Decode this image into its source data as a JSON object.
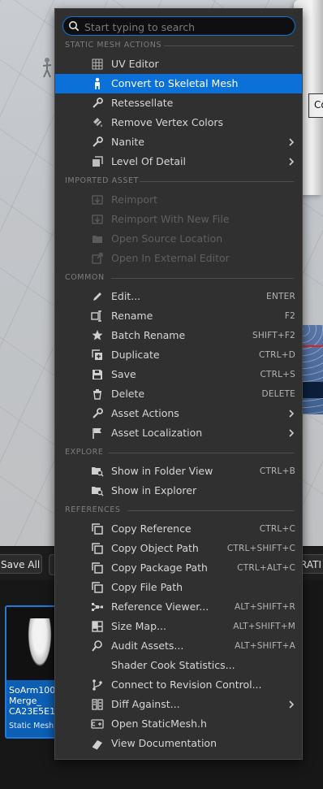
{
  "search": {
    "placeholder": "Start typing to search",
    "value": ""
  },
  "sections": {
    "static_mesh_actions": "STATIC MESH ACTIONS",
    "imported_asset": "IMPORTED ASSET",
    "common": "COMMON",
    "explore": "EXPLORE",
    "references": "REFERENCES"
  },
  "items": {
    "uv_editor": "UV Editor",
    "convert_skeletal": "Convert to Skeletal Mesh",
    "retessellate": "Retessellate",
    "remove_vertex_colors": "Remove Vertex Colors",
    "nanite": "Nanite",
    "level_of_detail": "Level Of Detail",
    "reimport": "Reimport",
    "reimport_new_file": "Reimport With New File",
    "open_source_location": "Open Source Location",
    "open_external_editor": "Open In External Editor",
    "edit": "Edit...",
    "rename": "Rename",
    "batch_rename": "Batch Rename",
    "duplicate": "Duplicate",
    "save": "Save",
    "delete": "Delete",
    "asset_actions": "Asset Actions",
    "asset_localization": "Asset Localization",
    "show_folder_view": "Show in Folder View",
    "show_explorer": "Show in Explorer",
    "copy_reference": "Copy Reference",
    "copy_object_path": "Copy Object Path",
    "copy_package_path": "Copy Package Path",
    "copy_file_path": "Copy File Path",
    "reference_viewer": "Reference Viewer...",
    "size_map": "Size Map...",
    "audit_assets": "Audit Assets...",
    "shader_cook_stats": "Shader Cook Statistics...",
    "connect_revision": "Connect to Revision Control...",
    "diff_against": "Diff Against...",
    "open_staticmesh_h": "Open StaticMesh.h",
    "view_documentation": "View Documentation"
  },
  "shortcuts": {
    "edit": "ENTER",
    "rename": "F2",
    "batch_rename": "SHIFT+F2",
    "duplicate": "CTRL+D",
    "save": "CTRL+S",
    "delete": "DELETE",
    "show_folder_view": "CTRL+B",
    "copy_reference": "CTRL+C",
    "copy_object_path": "CTRL+SHIFT+C",
    "copy_package_path": "CTRL+ALT+C",
    "reference_viewer": "ALT+SHIFT+R",
    "size_map": "ALT+SHIFT+M",
    "audit_assets": "ALT+SHIFT+A"
  },
  "background": {
    "save_all": "Save All",
    "right_button_fragment": "RATI",
    "tooltip_fragment": "Co",
    "asset": {
      "name": "SoArm100\nMerge_\nCA23E5E1",
      "type": "Static Mesh"
    }
  },
  "colors": {
    "accent": "#0b71d9",
    "menu_bg": "#303030",
    "asset_tile": "#0c5fb5"
  }
}
